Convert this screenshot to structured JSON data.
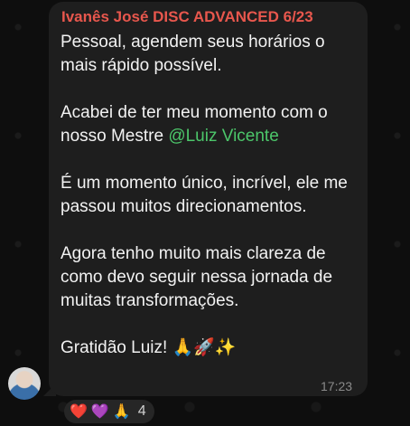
{
  "message": {
    "sender": "Ivanês José DISC ADVANCED 6/23",
    "paragraph1": "Pessoal, agendem seus horários o mais rápido possível.",
    "paragraph2_prefix": "Acabei de ter meu momento com o nosso Mestre ",
    "paragraph2_mention": "@Luiz Vicente",
    "paragraph3": "É um momento único, incrível, ele me passou muitos direcionamentos.",
    "paragraph4": "Agora tenho muito mais clareza de como devo seguir nessa jornada de muitas transformações.",
    "paragraph5": "Gratidão Luiz! 🙏🚀✨",
    "time": "17:23"
  },
  "reactions": {
    "emojis": [
      "❤️",
      "💜",
      "🙏"
    ],
    "count": "4"
  },
  "colors": {
    "sender": "#e8574d",
    "mention": "#4cc66a",
    "bubble": "#1e1e1e",
    "text": "#f2f2f2"
  }
}
